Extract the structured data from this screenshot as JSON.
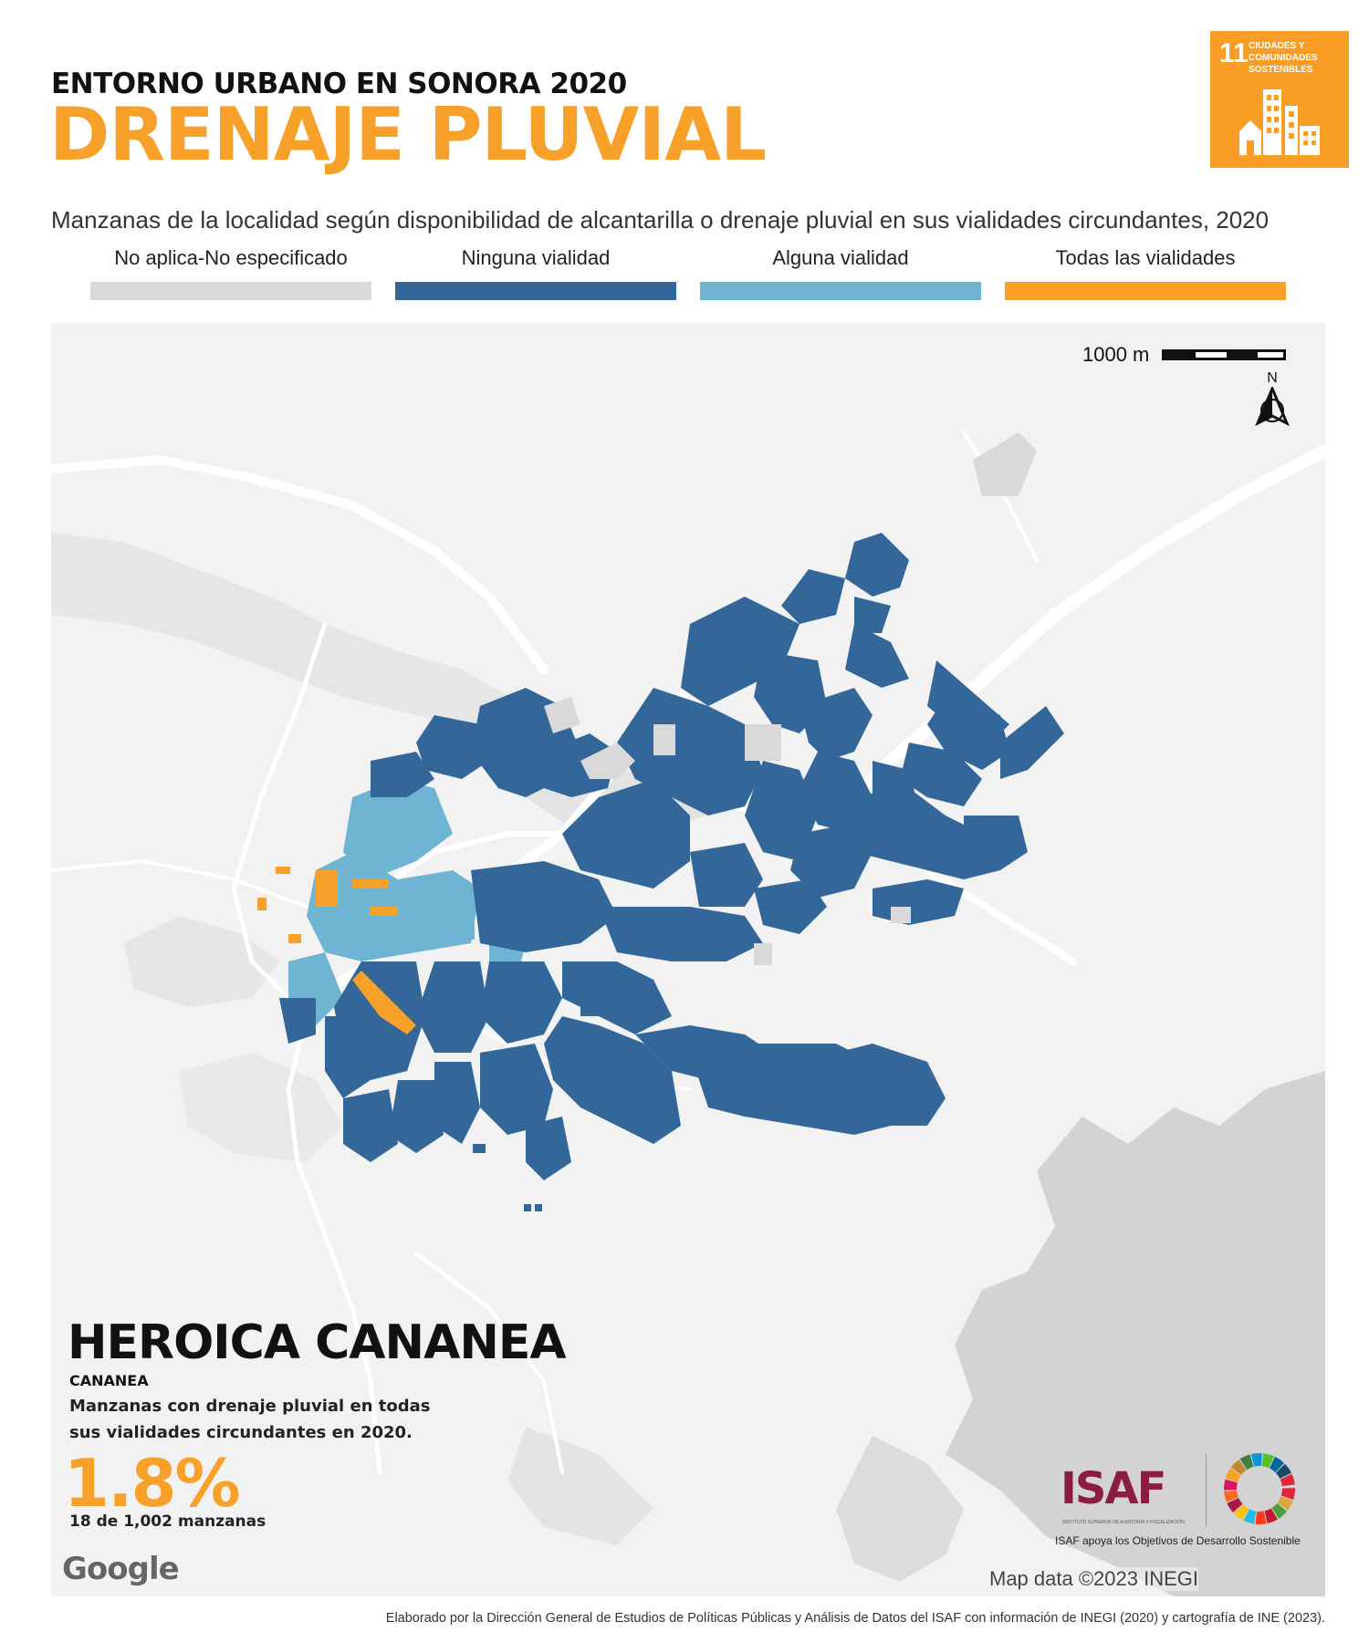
{
  "header": {
    "kicker": "ENTORNO URBANO EN SONORA 2020",
    "title": "DRENAJE PLUVIAL",
    "subtitle": "Manzanas de la localidad según disponibilidad de alcantarilla o drenaje pluvial en sus vialidades circundantes, 2020"
  },
  "sdg_badge": {
    "number": "11",
    "text": "CIUDADES Y COMUNIDADES SOSTENIBLES",
    "color": "#f99d26",
    "icon": "city-buildings-icon"
  },
  "legend": [
    {
      "label": "No aplica-No especificado",
      "color": "#d9d9d9"
    },
    {
      "label": "Ninguna vialidad",
      "color": "#336699"
    },
    {
      "label": "Alguna vialidad",
      "color": "#6fb5d3"
    },
    {
      "label": "Todas las vialidades",
      "color": "#f7a12b"
    }
  ],
  "map": {
    "scale_label": "1000 m",
    "north_label": "N",
    "locality": "HEROICA CANANEA",
    "municipality": "CANANEA",
    "stat_description": "Manzanas con drenaje pluvial en todas sus vialidades circundantes en 2020.",
    "stat_value": "1.8%",
    "stat_count": "18 de 1,002 manzanas",
    "basemap_logo": "Google",
    "attribution": "Map data ©2023 INEGI"
  },
  "branding": {
    "isaf_logo": "ISAF",
    "isaf_fullname": "INSTITUTO SUPERIOR DE AUDITORÍA Y FISCALIZACIÓN",
    "isaf_caption": "ISAF apoya los Objetivos de Desarrollo Sostenible",
    "sdg_wheel_icon": "sdg-wheel-icon"
  },
  "credits": "Elaborado por la Dirección General de Estudios de Políticas Públicas y Análisis de Datos del ISAF con información de INEGI (2020) y cartografía de INE (2023)."
}
